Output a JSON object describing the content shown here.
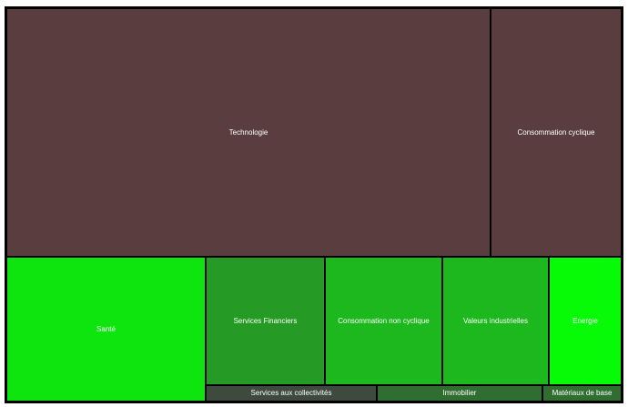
{
  "chart_data": {
    "type": "treemap",
    "sectors": [
      {
        "name": "Technologie",
        "value": 49.7,
        "color": "#5a3e3f"
      },
      {
        "name": "Consommation cyclique",
        "value": 13.5,
        "color": "#5a3e3f"
      },
      {
        "name": "Santé",
        "value": 11.9,
        "color": "#0ee40e"
      },
      {
        "name": "Services Financiers",
        "value": 6.8,
        "color": "#259b26"
      },
      {
        "name": "Consommation non cyclique",
        "value": 6.7,
        "color": "#1db81e"
      },
      {
        "name": "Valeurs industrielles",
        "value": 6.1,
        "color": "#1db81e"
      },
      {
        "name": "Energie",
        "value": 2.3,
        "color": "#07fb07"
      },
      {
        "name": "Services aux collectivités",
        "value": 1.4,
        "color": "#3e4a3e"
      },
      {
        "name": "Immobilier",
        "value": 1.4,
        "color": "#2f6e30"
      },
      {
        "name": "Matériaux de base",
        "value": 0.2,
        "color": "#2f6e30"
      }
    ]
  }
}
